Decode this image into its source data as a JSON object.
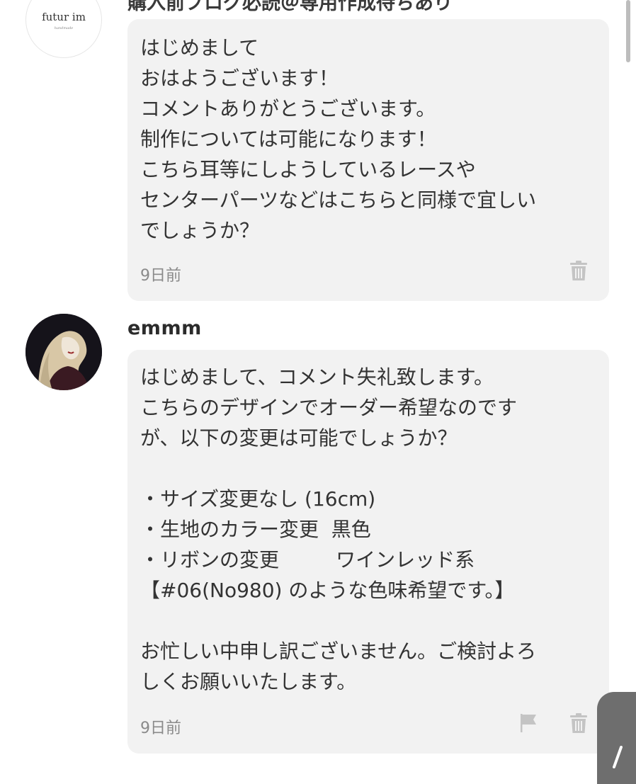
{
  "shop": {
    "logo_text": "futur im",
    "logo_subtext": "handmade",
    "header_text": "購入前ブログ必読＠専用作成待ちあり"
  },
  "comments": [
    {
      "author": "",
      "lines": [
        "はじめまして",
        "おはようございます！",
        "コメントありがとうございます。",
        "制作については可能になります！",
        "こちら耳等にしようしているレースや",
        "センターパーツなどはこちらと同様で宜しい",
        "でしょうか？"
      ],
      "time": "9日前",
      "icons": [
        "trash-icon"
      ]
    },
    {
      "author": "emmm",
      "lines": [
        "はじめまして、コメント失礼致します。",
        "こちらのデザインでオーダー希望なのです",
        "が、以下の変更は可能でしょうか？",
        "",
        "・サイズ変更なし (16cm)",
        "・生地のカラー変更  黒色",
        "・リボンの変更         ワインレッド系",
        "【#06(No980) のような色味希望です。】",
        "",
        "お忙しい中申し訳ございません。ご検討よろ",
        "しくお願いいたします。"
      ],
      "time": "9日前",
      "icons": [
        "flag-icon",
        "trash-icon"
      ]
    }
  ],
  "colors": {
    "bubble_bg": "#f2f2f2",
    "text": "#333333",
    "meta": "#8a8a8a",
    "icon": "#c4c4c4"
  }
}
